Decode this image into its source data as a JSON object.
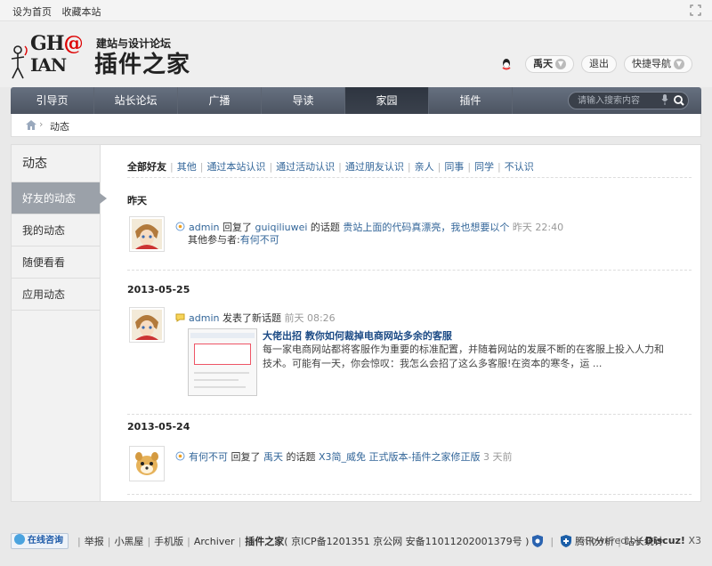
{
  "topbar": {
    "set_home": "设为首页",
    "bookmark": "收藏本站"
  },
  "logo": {
    "line1_a": "GH",
    "line1_at": "@",
    "line2": "IAN",
    "subtitle": "建站与设计论坛",
    "brand": "插件之家"
  },
  "user": {
    "name": "禹天",
    "logout": "退出",
    "quick_nav": "快捷导航"
  },
  "nav": {
    "items": [
      "引导页",
      "站长论坛",
      "广播",
      "导读",
      "家园",
      "插件"
    ],
    "active_index": 4,
    "search_placeholder": "请输入搜索内容"
  },
  "breadcrumb": {
    "separator": "›",
    "current": "动态"
  },
  "sidebar": {
    "title": "动态",
    "items": [
      "好友的动态",
      "我的动态",
      "随便看看",
      "应用动态"
    ],
    "active_index": 0
  },
  "filters": [
    "全部好友",
    "其他",
    "通过本站认识",
    "通过活动认识",
    "通过朋友认识",
    "亲人",
    "同事",
    "同学",
    "不认识"
  ],
  "groups": [
    {
      "day": "昨天",
      "user": "admin",
      "action": "回复了",
      "target_user": "guiqiliuwei",
      "mid": "的话题",
      "topic": "贵站上面的代码真漂亮，我也想要以个",
      "time": "昨天 22:40",
      "extra_label": "其他参与者:",
      "extra_user": "有何不可"
    },
    {
      "day": "2013-05-25",
      "user": "admin",
      "action": "发表了新话题",
      "time": "前天 08:26",
      "post_title": "大佬出招 教你如何裁掉电商网站多余的客服",
      "post_desc": "每一家电商网站都将客服作为重要的标准配置，并随着网站的发展不断的在客服上投入人力和技术。可能有一天，你会惊叹：我怎么会招了这么多客服!在资本的寒冬，运 ..."
    },
    {
      "day": "2013-05-24",
      "user": "有何不可",
      "action": "回复了",
      "target_user": "禹天",
      "mid": "的话题",
      "topic": "X3简_威免 正式版本-插件之家修正版",
      "time": "3 天前"
    }
  ],
  "footer": {
    "online": "在线咨询",
    "links": [
      "举报",
      "小黑屋",
      "手机版",
      "Archiver"
    ],
    "site": "插件之家",
    "icp": "( 京ICP备1201351 京公网 安备11011202001379号 )",
    "analytics": "腾讯分析",
    "stats": "站长统计",
    "powered_prefix": "Powered by",
    "powered_brand": "Discuz!",
    "powered_ver": "X3"
  },
  "colors": {
    "nav_bg": "#4c5461",
    "link": "#336699",
    "post_title": "#1b4a85",
    "accent_red": "#dd0000"
  }
}
